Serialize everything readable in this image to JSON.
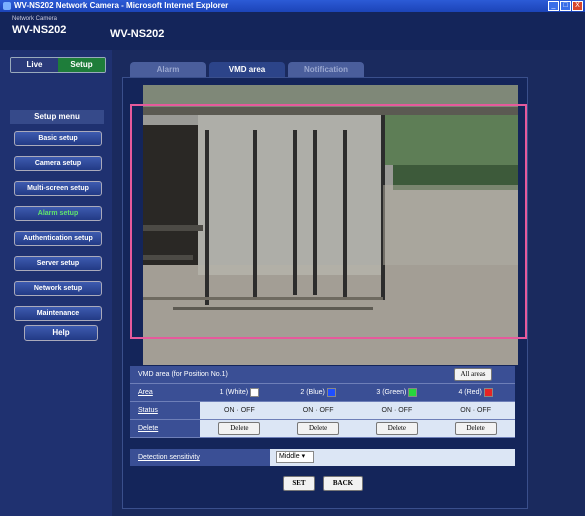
{
  "window": {
    "title": "WV-NS202 Network Camera - Microsoft Internet Explorer",
    "buttons": [
      "_",
      "□",
      "X"
    ]
  },
  "header": {
    "brand_sub": "Network Camera",
    "brand_main": "WV-NS202",
    "model": "WV-NS202"
  },
  "mode": {
    "live": "Live",
    "setup": "Setup"
  },
  "sidebar": {
    "title": "Setup menu",
    "items": [
      "Basic setup",
      "Camera setup",
      "Multi-screen setup",
      "Alarm setup",
      "Authentication setup",
      "Server setup",
      "Network setup",
      "Maintenance"
    ],
    "help": "Help"
  },
  "tabs": [
    "Alarm",
    "VMD area",
    "Notification"
  ],
  "vmd": {
    "title": "VMD area (for Position No.1)",
    "all_areas_button": "All areas",
    "rows": {
      "area": "Area",
      "status": "Status",
      "delete": "Delete"
    },
    "areas": [
      {
        "label": "1 (White)",
        "color": "#ffffff",
        "status": "ON · OFF",
        "delete": "Delete"
      },
      {
        "label": "2 (Blue)",
        "color": "#1f4fff",
        "status": "ON · OFF",
        "delete": "Delete"
      },
      {
        "label": "3 (Green)",
        "color": "#27d63c",
        "status": "ON · OFF",
        "delete": "Delete"
      },
      {
        "label": "4 (Red)",
        "color": "#e62424",
        "status": "ON · OFF",
        "delete": "Delete"
      }
    ],
    "sensitivity_label": "Detection sensitivity",
    "sensitivity_value": "Middle"
  },
  "actions": {
    "set": "SET",
    "back": "BACK"
  },
  "colors": {
    "accent_green": "#1e7d3a",
    "vmd_frame": "#e65a9c",
    "panel": "#14255a"
  }
}
